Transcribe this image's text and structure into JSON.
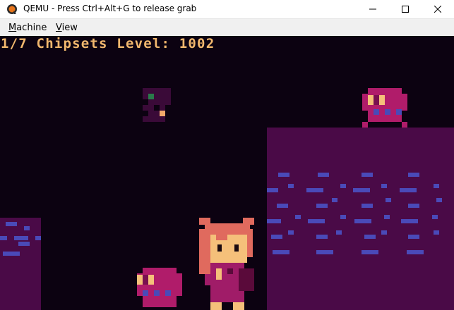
{
  "window": {
    "title": "QEMU - Press Ctrl+Alt+G to release grab",
    "icons": {
      "app": "qemu-logo-icon",
      "minimize": "minimize-icon",
      "maximize": "maximize-icon",
      "close": "close-icon"
    }
  },
  "menubar": {
    "items": [
      {
        "underline": "M",
        "rest": "achine"
      },
      {
        "underline": "V",
        "rest": "iew"
      }
    ]
  },
  "game": {
    "hud_text": "1/7 Chipsets Level: 1002",
    "colors": {
      "background": "#0c0211",
      "hud": "#f2b86e",
      "platform": "#4a0a47",
      "brick": "#4a4ab8",
      "enemy": "#b01c6a",
      "hero_hair": "#e06a5e",
      "hero_skin": "#f5c07a",
      "hero_dress": "#a01c68"
    },
    "sprites": [
      "pickup-chip-icon",
      "enemy-creature-icon",
      "player-character-icon"
    ]
  }
}
